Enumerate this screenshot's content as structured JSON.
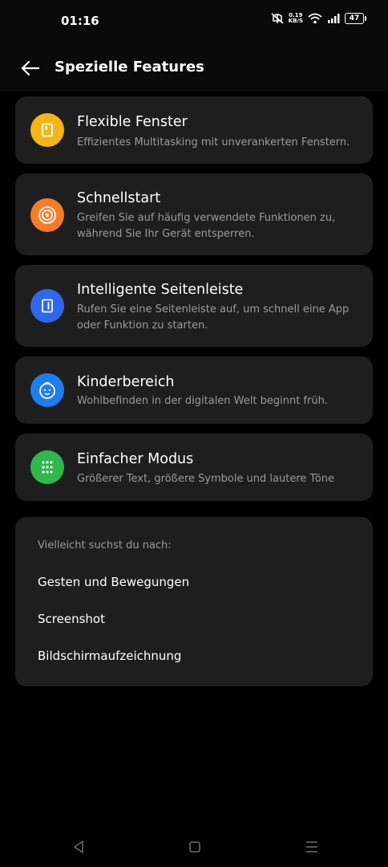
{
  "status": {
    "time": "01:16",
    "net_speed_value": "0.19",
    "net_speed_unit": "KB/S",
    "battery": "47"
  },
  "header": {
    "title": "Spezielle Features"
  },
  "features": [
    {
      "title": "Flexible Fenster",
      "desc": "Effizientes Multitasking mit unverankerten Fenstern.",
      "icon": "window-icon",
      "color": "#f5b514"
    },
    {
      "title": "Schnellstart",
      "desc": "Greifen Sie auf häufig verwendete Funktionen zu, während Sie Ihr Gerät entsperren.",
      "icon": "target-icon",
      "color": "#f57c2a"
    },
    {
      "title": "Intelligente Seitenleiste",
      "desc": "Rufen Sie eine Seitenleiste auf, um schnell eine App oder Funktion zu starten.",
      "icon": "sidebar-icon",
      "color": "#2f68e8"
    },
    {
      "title": "Kinderbereich",
      "desc": "Wohlbefinden in der digitalen Welt beginnt früh.",
      "icon": "child-face-icon",
      "color": "#1e7ef0"
    },
    {
      "title": "Einfacher Modus",
      "desc": "Größerer Text, größere Symbole und lautere Töne",
      "icon": "grid-dots-icon",
      "color": "#2fb84e"
    }
  ],
  "suggestions": {
    "title": "Vielleicht suchst du nach:",
    "items": [
      "Gesten und Bewegungen",
      "Screenshot",
      "Bildschirmaufzeichnung"
    ]
  }
}
